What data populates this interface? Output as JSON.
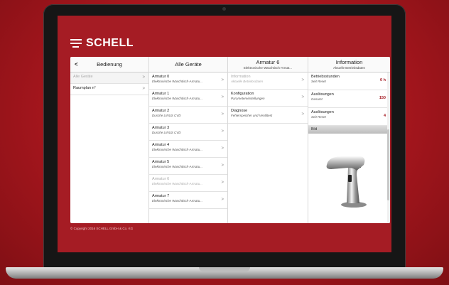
{
  "brand": "SCHELL",
  "copyright": "© Copyright 2016 SCHELL GmbH & Co. KG",
  "columns": {
    "bedienung": {
      "back": "<",
      "title": "Bedienung",
      "items": [
        {
          "label": "Alle Geräte",
          "disabled": true
        },
        {
          "label": "Raumplan n°",
          "disabled": false
        }
      ]
    },
    "alle_geraete": {
      "title": "Alle Geräte",
      "items": [
        {
          "label": "Armatur 0",
          "sub": "Elektronische Waschtisch-Armatu..."
        },
        {
          "label": "Armatur 1",
          "sub": "Elektronische Waschtisch-Armatu..."
        },
        {
          "label": "Armatur 2",
          "sub": "Dusche LINUS CVD"
        },
        {
          "label": "Armatur 3",
          "sub": "Dusche LINUS CVD"
        },
        {
          "label": "Armatur 4",
          "sub": "Elektronische Waschtisch-Armatu..."
        },
        {
          "label": "Armatur 5",
          "sub": "Elektronische Waschtisch-Armatu..."
        },
        {
          "label": "Armatur 6",
          "sub": "Elektronische Waschtisch-Armatu...",
          "disabled": true
        },
        {
          "label": "Armatur 7",
          "sub": "Elektronische Waschtisch-Armatu..."
        }
      ]
    },
    "armatur6": {
      "title": "Armatur 6",
      "subtitle": "Elektronische Waschtisch-Armat...",
      "items": [
        {
          "label": "Information",
          "sub": "Aktuelle Betriebsdaten",
          "disabled": true
        },
        {
          "label": "Konfiguration",
          "sub": "Parametereinstellungen"
        },
        {
          "label": "Diagnose",
          "sub": "Fehlerspeicher und Ventiltest"
        }
      ]
    },
    "information": {
      "title": "Information",
      "subtitle": "Aktuelle Betriebsdaten",
      "items": [
        {
          "label": "Betriebsstunden",
          "sub": "Seit Reset",
          "value": "0 h"
        },
        {
          "label": "Auslösungen",
          "sub": "Gesamt",
          "value": "150"
        },
        {
          "label": "Auslösungen",
          "sub": "Seit Reset",
          "value": "4"
        }
      ],
      "image_header": "Bild"
    }
  },
  "chevron": ">",
  "colors": {
    "brand_red": "#a51c24",
    "value_red": "#a51c24"
  }
}
